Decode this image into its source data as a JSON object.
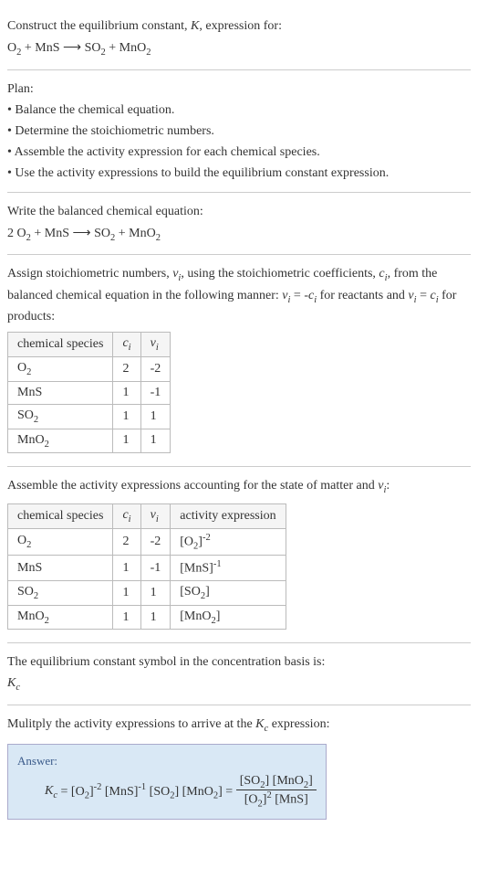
{
  "intro": {
    "title": "Construct the equilibrium constant, K, expression for:",
    "equation": "O₂ + MnS ⟶ SO₂ + MnO₂"
  },
  "plan": {
    "heading": "Plan:",
    "bullets": [
      "• Balance the chemical equation.",
      "• Determine the stoichiometric numbers.",
      "• Assemble the activity expression for each chemical species.",
      "• Use the activity expressions to build the equilibrium constant expression."
    ]
  },
  "balanced": {
    "heading": "Write the balanced chemical equation:",
    "equation": "2 O₂ + MnS ⟶ SO₂ + MnO₂"
  },
  "stoich": {
    "text1": "Assign stoichiometric numbers, νᵢ, using the stoichiometric coefficients, cᵢ, from the balanced chemical equation in the following manner: νᵢ = -cᵢ for reactants and νᵢ = cᵢ for products:",
    "headers": [
      "chemical species",
      "cᵢ",
      "νᵢ"
    ],
    "rows": [
      [
        "O₂",
        "2",
        "-2"
      ],
      [
        "MnS",
        "1",
        "-1"
      ],
      [
        "SO₂",
        "1",
        "1"
      ],
      [
        "MnO₂",
        "1",
        "1"
      ]
    ]
  },
  "activity": {
    "text1": "Assemble the activity expressions accounting for the state of matter and νᵢ:",
    "headers": [
      "chemical species",
      "cᵢ",
      "νᵢ",
      "activity expression"
    ],
    "rows": [
      {
        "sp": "O₂",
        "c": "2",
        "v": "-2",
        "ae_base": "[O₂]",
        "ae_exp": "-2"
      },
      {
        "sp": "MnS",
        "c": "1",
        "v": "-1",
        "ae_base": "[MnS]",
        "ae_exp": "-1"
      },
      {
        "sp": "SO₂",
        "c": "1",
        "v": "1",
        "ae_base": "[SO₂]",
        "ae_exp": ""
      },
      {
        "sp": "MnO₂",
        "c": "1",
        "v": "1",
        "ae_base": "[MnO₂]",
        "ae_exp": ""
      }
    ]
  },
  "symbol": {
    "text": "The equilibrium constant symbol in the concentration basis is:",
    "sym": "K𝒸"
  },
  "multiply": {
    "text": "Mulitply the activity expressions to arrive at the K𝒸 expression:"
  },
  "answer": {
    "label": "Answer:",
    "lhs": "K𝒸 = [O₂]⁻² [MnS]⁻¹ [SO₂] [MnO₂] = ",
    "frac_num": "[SO₂] [MnO₂]",
    "frac_den": "[O₂]² [MnS]"
  }
}
